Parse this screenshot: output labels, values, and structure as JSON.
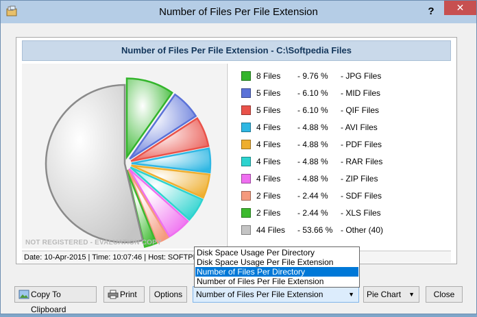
{
  "window": {
    "title": "Number of Files Per File Extension",
    "help_label": "?",
    "close_label": "✕"
  },
  "report": {
    "header": "Number of Files Per File Extension - C:\\Softpedia Files",
    "watermark": "NOT REGISTERED - EVALUATION COPY",
    "status": "Date: 10-Apr-2015 | Time: 10:07:46 | Host: SOFTPEDIA"
  },
  "legend": [
    {
      "count": "8 Files",
      "pct": "- 9.76 %",
      "ext": "- JPG Files",
      "color": "#33b52b"
    },
    {
      "count": "5 Files",
      "pct": "- 6.10 %",
      "ext": "- MID Files",
      "color": "#5b72d8"
    },
    {
      "count": "5 Files",
      "pct": "- 6.10 %",
      "ext": "- QIF Files",
      "color": "#e9524a"
    },
    {
      "count": "4 Files",
      "pct": "- 4.88 %",
      "ext": "- AVI Files",
      "color": "#2fb7e3"
    },
    {
      "count": "4 Files",
      "pct": "- 4.88 %",
      "ext": "- PDF Files",
      "color": "#eeae2f"
    },
    {
      "count": "4 Files",
      "pct": "- 4.88 %",
      "ext": "- RAR Files",
      "color": "#2dd3cf"
    },
    {
      "count": "4 Files",
      "pct": "- 4.88 %",
      "ext": "- ZIP Files",
      "color": "#ef6ff0"
    },
    {
      "count": "2 Files",
      "pct": "- 2.44 %",
      "ext": "- SDF Files",
      "color": "#f59a7e"
    },
    {
      "count": "2 Files",
      "pct": "- 2.44 %",
      "ext": "- XLS Files",
      "color": "#3cba2e"
    },
    {
      "count": "44 Files",
      "pct": "- 53.66 %",
      "ext": "- Other (40)",
      "color": "#c4c4c4"
    }
  ],
  "chart_data": {
    "type": "pie",
    "title": "Number of Files Per File Extension - C:\\Softpedia Files",
    "labels": [
      "JPG Files",
      "MID Files",
      "QIF Files",
      "AVI Files",
      "PDF Files",
      "RAR Files",
      "ZIP Files",
      "SDF Files",
      "XLS Files",
      "Other (40)"
    ],
    "values": [
      8,
      5,
      5,
      4,
      4,
      4,
      4,
      2,
      2,
      44
    ],
    "percentages": [
      9.76,
      6.1,
      6.1,
      4.88,
      4.88,
      4.88,
      4.88,
      2.44,
      2.44,
      53.66
    ],
    "exploded": true,
    "legend_position": "right"
  },
  "toolbar": {
    "copy_label": "Copy To Clipboard",
    "print_label": "Print",
    "options_label": "Options",
    "report_select_value": "Number of Files Per File Extension",
    "chart_type_value": "Pie Chart",
    "close_label": "Close"
  },
  "dropdown_options": [
    {
      "label": "Disk Space Usage Per Directory",
      "selected": false
    },
    {
      "label": "Disk Space Usage Per File Extension",
      "selected": false
    },
    {
      "label": "Number of Files Per Directory",
      "selected": true
    },
    {
      "label": "Number of Files Per File Extension",
      "selected": false
    }
  ]
}
